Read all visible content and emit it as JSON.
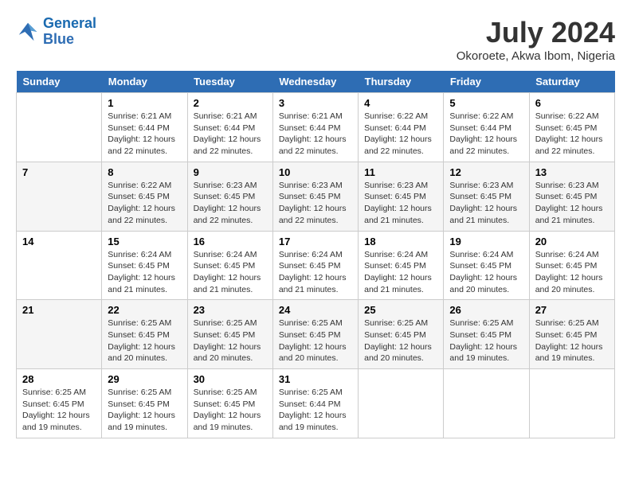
{
  "header": {
    "logo_line1": "General",
    "logo_line2": "Blue",
    "month_year": "July 2024",
    "location": "Okoroete, Akwa Ibom, Nigeria"
  },
  "weekdays": [
    "Sunday",
    "Monday",
    "Tuesday",
    "Wednesday",
    "Thursday",
    "Friday",
    "Saturday"
  ],
  "weeks": [
    [
      {
        "day": "",
        "info": ""
      },
      {
        "day": "1",
        "info": "Sunrise: 6:21 AM\nSunset: 6:44 PM\nDaylight: 12 hours\nand 22 minutes."
      },
      {
        "day": "2",
        "info": "Sunrise: 6:21 AM\nSunset: 6:44 PM\nDaylight: 12 hours\nand 22 minutes."
      },
      {
        "day": "3",
        "info": "Sunrise: 6:21 AM\nSunset: 6:44 PM\nDaylight: 12 hours\nand 22 minutes."
      },
      {
        "day": "4",
        "info": "Sunrise: 6:22 AM\nSunset: 6:44 PM\nDaylight: 12 hours\nand 22 minutes."
      },
      {
        "day": "5",
        "info": "Sunrise: 6:22 AM\nSunset: 6:44 PM\nDaylight: 12 hours\nand 22 minutes."
      },
      {
        "day": "6",
        "info": "Sunrise: 6:22 AM\nSunset: 6:45 PM\nDaylight: 12 hours\nand 22 minutes."
      }
    ],
    [
      {
        "day": "7",
        "info": ""
      },
      {
        "day": "8",
        "info": "Sunrise: 6:22 AM\nSunset: 6:45 PM\nDaylight: 12 hours\nand 22 minutes."
      },
      {
        "day": "9",
        "info": "Sunrise: 6:23 AM\nSunset: 6:45 PM\nDaylight: 12 hours\nand 22 minutes."
      },
      {
        "day": "10",
        "info": "Sunrise: 6:23 AM\nSunset: 6:45 PM\nDaylight: 12 hours\nand 22 minutes."
      },
      {
        "day": "11",
        "info": "Sunrise: 6:23 AM\nSunset: 6:45 PM\nDaylight: 12 hours\nand 21 minutes."
      },
      {
        "day": "12",
        "info": "Sunrise: 6:23 AM\nSunset: 6:45 PM\nDaylight: 12 hours\nand 21 minutes."
      },
      {
        "day": "13",
        "info": "Sunrise: 6:23 AM\nSunset: 6:45 PM\nDaylight: 12 hours\nand 21 minutes."
      }
    ],
    [
      {
        "day": "14",
        "info": ""
      },
      {
        "day": "15",
        "info": "Sunrise: 6:24 AM\nSunset: 6:45 PM\nDaylight: 12 hours\nand 21 minutes."
      },
      {
        "day": "16",
        "info": "Sunrise: 6:24 AM\nSunset: 6:45 PM\nDaylight: 12 hours\nand 21 minutes."
      },
      {
        "day": "17",
        "info": "Sunrise: 6:24 AM\nSunset: 6:45 PM\nDaylight: 12 hours\nand 21 minutes."
      },
      {
        "day": "18",
        "info": "Sunrise: 6:24 AM\nSunset: 6:45 PM\nDaylight: 12 hours\nand 21 minutes."
      },
      {
        "day": "19",
        "info": "Sunrise: 6:24 AM\nSunset: 6:45 PM\nDaylight: 12 hours\nand 20 minutes."
      },
      {
        "day": "20",
        "info": "Sunrise: 6:24 AM\nSunset: 6:45 PM\nDaylight: 12 hours\nand 20 minutes."
      }
    ],
    [
      {
        "day": "21",
        "info": ""
      },
      {
        "day": "22",
        "info": "Sunrise: 6:25 AM\nSunset: 6:45 PM\nDaylight: 12 hours\nand 20 minutes."
      },
      {
        "day": "23",
        "info": "Sunrise: 6:25 AM\nSunset: 6:45 PM\nDaylight: 12 hours\nand 20 minutes."
      },
      {
        "day": "24",
        "info": "Sunrise: 6:25 AM\nSunset: 6:45 PM\nDaylight: 12 hours\nand 20 minutes."
      },
      {
        "day": "25",
        "info": "Sunrise: 6:25 AM\nSunset: 6:45 PM\nDaylight: 12 hours\nand 20 minutes."
      },
      {
        "day": "26",
        "info": "Sunrise: 6:25 AM\nSunset: 6:45 PM\nDaylight: 12 hours\nand 19 minutes."
      },
      {
        "day": "27",
        "info": "Sunrise: 6:25 AM\nSunset: 6:45 PM\nDaylight: 12 hours\nand 19 minutes."
      }
    ],
    [
      {
        "day": "28",
        "info": "Sunrise: 6:25 AM\nSunset: 6:45 PM\nDaylight: 12 hours\nand 19 minutes."
      },
      {
        "day": "29",
        "info": "Sunrise: 6:25 AM\nSunset: 6:45 PM\nDaylight: 12 hours\nand 19 minutes."
      },
      {
        "day": "30",
        "info": "Sunrise: 6:25 AM\nSunset: 6:45 PM\nDaylight: 12 hours\nand 19 minutes."
      },
      {
        "day": "31",
        "info": "Sunrise: 6:25 AM\nSunset: 6:44 PM\nDaylight: 12 hours\nand 19 minutes."
      },
      {
        "day": "",
        "info": ""
      },
      {
        "day": "",
        "info": ""
      },
      {
        "day": "",
        "info": ""
      }
    ]
  ]
}
